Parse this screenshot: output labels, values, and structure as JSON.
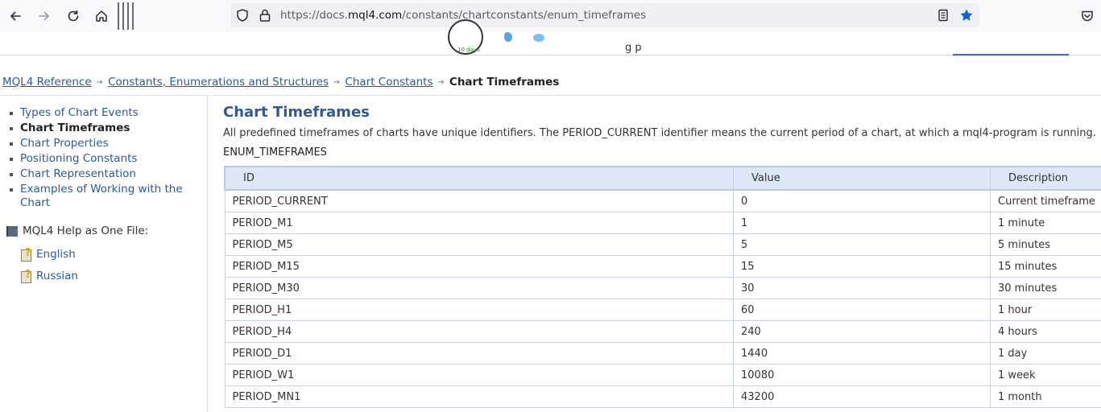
{
  "browser": {
    "url_prefix": "https://docs.",
    "url_domain": "mql4.com",
    "url_path": "/constants/chartconstants/enum_timeframes"
  },
  "header": {
    "logo_small_text": "10 days"
  },
  "breadcrumb": {
    "items": [
      "MQL4 Reference",
      "Constants, Enumerations and Structures",
      "Chart Constants"
    ],
    "current": "Chart Timeframes"
  },
  "sidebar": {
    "items": [
      {
        "label": "Types of Chart Events",
        "active": false
      },
      {
        "label": "Chart Timeframes",
        "active": true
      },
      {
        "label": "Chart Properties",
        "active": false
      },
      {
        "label": "Positioning Constants",
        "active": false
      },
      {
        "label": "Chart Representation",
        "active": false
      },
      {
        "label": "Examples of Working with the Chart",
        "active": false
      }
    ],
    "help_title": "MQL4 Help as One File:",
    "help_links": [
      "English",
      "Russian"
    ]
  },
  "main": {
    "title": "Chart Timeframes",
    "description": "All predefined timeframes of charts have unique identifiers. The PERIOD_CURRENT identifier means the current period of a chart, at which a mql4-program is running.",
    "enum_name": "ENUM_TIMEFRAMES",
    "table": {
      "headers": [
        "ID",
        "Value",
        "Description"
      ],
      "rows": [
        [
          "PERIOD_CURRENT",
          "0",
          "Current timeframe"
        ],
        [
          "PERIOD_M1",
          "1",
          "1 minute"
        ],
        [
          "PERIOD_M5",
          "5",
          "5 minutes"
        ],
        [
          "PERIOD_M15",
          "15",
          "15 minutes"
        ],
        [
          "PERIOD_M30",
          "30",
          "30 minutes"
        ],
        [
          "PERIOD_H1",
          "60",
          "1 hour"
        ],
        [
          "PERIOD_H4",
          "240",
          "4 hours"
        ],
        [
          "PERIOD_D1",
          "1440",
          "1 day"
        ],
        [
          "PERIOD_W1",
          "10080",
          "1 week"
        ],
        [
          "PERIOD_MN1",
          "43200",
          "1 month"
        ]
      ]
    }
  },
  "colors": {
    "link": "#2a5a9c",
    "title": "#2f5a94",
    "table_header_bg": "#dce8f7",
    "accent_star": "#0a64d8"
  }
}
